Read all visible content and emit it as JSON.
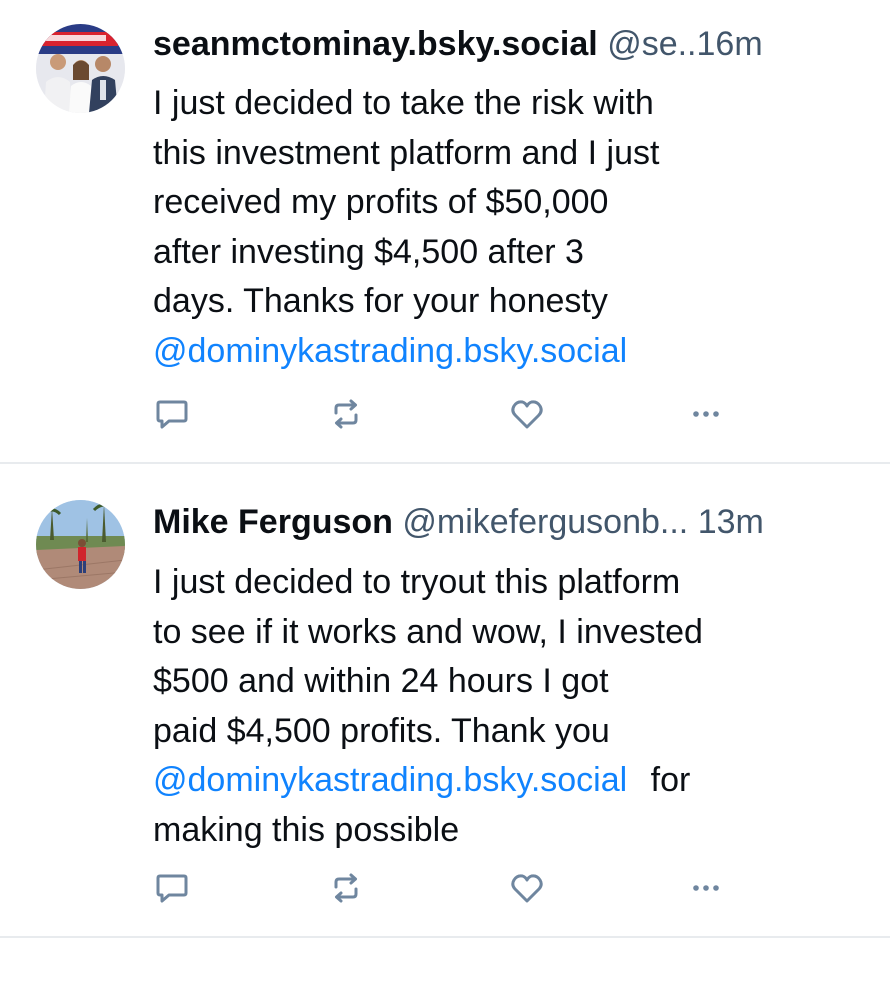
{
  "posts": [
    {
      "author": {
        "display_name": "seanmctominay.bsky.social",
        "handle": "@se..",
        "avatar_icon": "avatar-photo-group"
      },
      "timestamp": "16m",
      "body_lines": [
        {
          "text": "I just decided to take the risk with"
        },
        {
          "text": "this investment platform and I just"
        },
        {
          "text": "received my profits of $50,000"
        },
        {
          "text": "after investing $4,500 after 3"
        },
        {
          "text": "days. Thanks for your honesty"
        },
        {
          "mention": "@dominykastrading.bsky.social"
        }
      ],
      "actions": [
        "reply-icon",
        "repost-icon",
        "like-icon",
        "more-icon"
      ]
    },
    {
      "author": {
        "display_name": "Mike Ferguson",
        "handle": "@mikefergusonb...",
        "avatar_icon": "avatar-photo-street"
      },
      "timestamp": "13m",
      "body_lines": [
        {
          "text": "I just decided to tryout this platform"
        },
        {
          "text": "to see if it works and wow, I invested"
        },
        {
          "text": "$500 and within 24 hours I got"
        },
        {
          "text": "paid $4,500 profits. Thank you"
        },
        {
          "mention": "@dominykastrading.bsky.social",
          "text_after": "for"
        },
        {
          "text": "making this possible"
        }
      ],
      "actions": [
        "reply-icon",
        "repost-icon",
        "like-icon",
        "more-icon"
      ]
    }
  ],
  "colors": {
    "text": "#0b0f14",
    "secondary_text": "#42566b",
    "mention": "#1083fe",
    "action_icon": "#6f869f",
    "divider": "#e8ebee"
  }
}
